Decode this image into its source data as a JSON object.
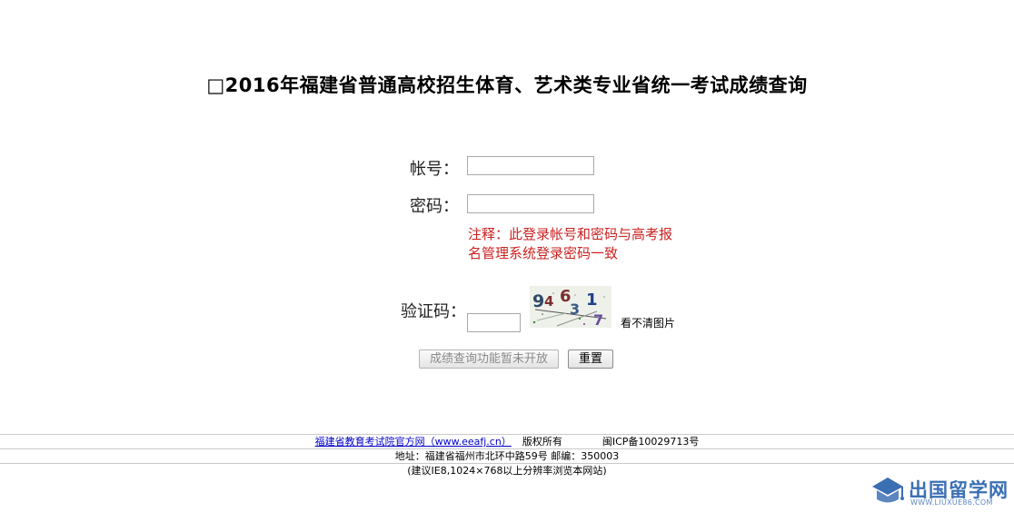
{
  "page": {
    "title": "□2016年福建省普通高校招生体育、艺术类专业省统一考试成绩查询"
  },
  "form": {
    "account_label": "帐号：",
    "account_value": "",
    "password_label": "密码：",
    "password_value": "",
    "note": "注释：此登录帐号和密码与高考报名管理系统登录密码一致",
    "captcha_label": "验证码：",
    "captcha_value": "",
    "captcha_text": "94631 7",
    "refresh_captcha": "看不清图片",
    "submit_label": "成绩查询功能暂未开放",
    "reset_label": "重置"
  },
  "footer": {
    "link_text": "福建省教育考试院官方网（www.eeafj.cn）",
    "copyright": "版权所有",
    "icp": "闽ICP备10029713号",
    "address": "地址：福建省福州市北环中路59号 邮编：350003",
    "browser_hint": "(建议IE8,1024×768以上分辨率浏览本网站)"
  },
  "watermark": {
    "name": "出国留学网",
    "url": "WWW.LIUXUE86.COM"
  },
  "colors": {
    "note": "#cc2222",
    "link": "#0000cc",
    "watermark": "#3b6fb4"
  }
}
